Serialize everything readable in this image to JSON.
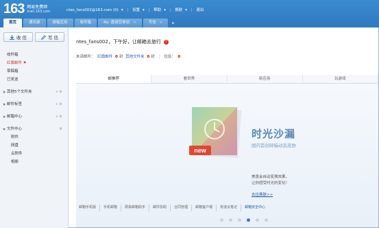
{
  "header": {
    "logo_number": "163",
    "logo_name": "网易免费邮",
    "logo_domain": "mail.163.com",
    "account": "ntes_fans002@163.com (0)",
    "links": [
      "设置",
      "帮助",
      "换肤",
      "退出"
    ]
  },
  "tabs": [
    {
      "label": "首页",
      "active": true
    },
    {
      "label": "通讯录",
      "active": false
    },
    {
      "label": "邮箱应用",
      "active": false
    },
    {
      "label": "收件箱",
      "active": false
    },
    {
      "label": "Re: 邀请您参加",
      "active": false
    },
    {
      "label": "写信",
      "active": false
    }
  ],
  "sidebar": {
    "receive_label": "收 信",
    "compose_label": "写 信",
    "items": [
      {
        "label": "收件箱",
        "type": "normal"
      },
      {
        "label": "红旗邮件",
        "type": "red"
      },
      {
        "label": "草稿箱",
        "type": "normal"
      },
      {
        "label": "已发送",
        "type": "normal"
      },
      {
        "label": "其他5个文件夹",
        "type": "expander"
      },
      {
        "label": "邮件标签",
        "type": "expander"
      },
      {
        "label": "邮箱中心",
        "type": "expander"
      },
      {
        "label": "文件中心",
        "type": "expanded"
      },
      {
        "label": "附件",
        "type": "sub"
      },
      {
        "label": "网盘",
        "type": "sub"
      },
      {
        "label": "云附件",
        "type": "sub"
      },
      {
        "label": "相册",
        "type": "sub"
      }
    ]
  },
  "main": {
    "greeting": "ntes_fans002，下午好，让邮箱去旅行",
    "warn_icon_glyph": "!",
    "stats": {
      "prefix": "未读邮件：",
      "red_flag_label": "红旗邮件",
      "red_flag_count": "0",
      "red_flag_unit": "封",
      "pending_label": "其他文件夹",
      "pending_count": "0",
      "pending_unit": "封",
      "divider": "|",
      "spam_label": "垃圾：",
      "spam_count": "0"
    },
    "promo_tabs": [
      "邮推荐",
      "看世界",
      "新应用",
      "玩游戏"
    ],
    "promo": {
      "title": "时光沙漏",
      "subtitle": "国内首创邮箱动态皮肤",
      "badge": "new",
      "desc_line1": "美景会自动变换效果，",
      "desc_line2": "让你感受时光的变化！",
      "link": "去往换肤>>",
      "dots": 6,
      "active_dot": 3
    },
    "footer_links": [
      "邮箱手机版",
      "手机邮箱",
      "网易邮箱助手",
      "邮件协助",
      "合同管理",
      "邮箱客户端",
      "有道云笔记",
      "邮箱安全中心"
    ]
  },
  "colors": {
    "header_blue": "#3a8bd0",
    "link_blue": "#1e5aa8",
    "promo_blue": "#5a88b8",
    "alert_red": "#d9342b"
  }
}
